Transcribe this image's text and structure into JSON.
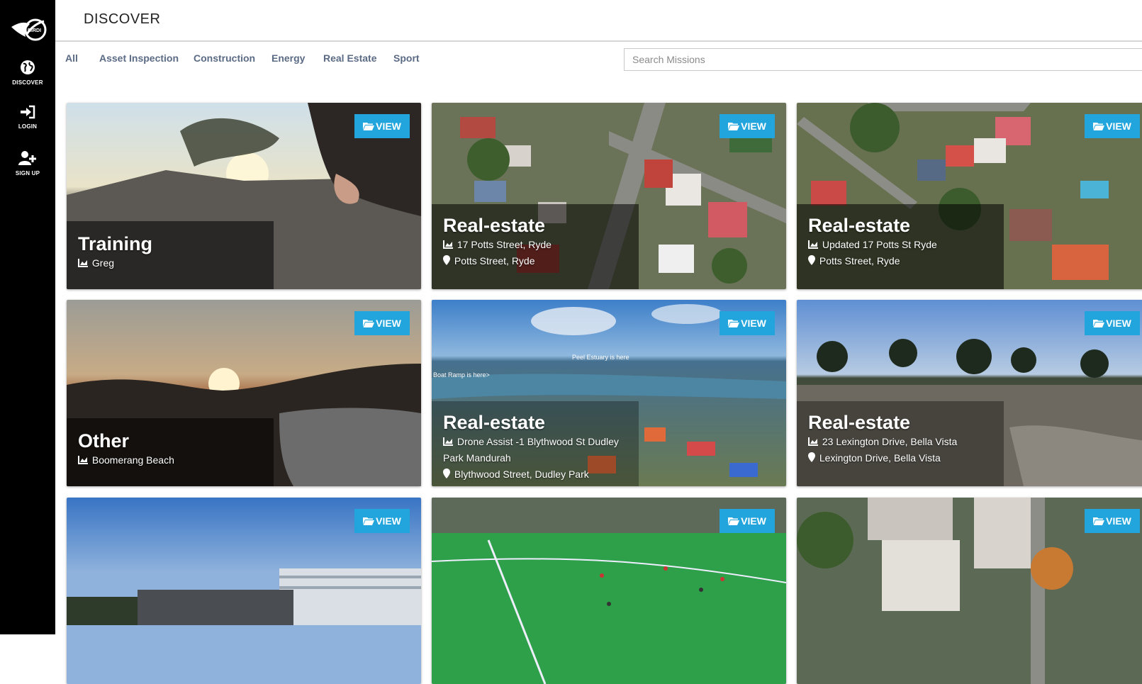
{
  "brand": {
    "logo_text": "BIRDI"
  },
  "sidebar": {
    "items": [
      {
        "label": "DISCOVER",
        "icon": "globe-icon"
      },
      {
        "label": "LOGIN",
        "icon": "login-icon"
      },
      {
        "label": "SIGN UP",
        "icon": "add-user-icon"
      }
    ]
  },
  "header": {
    "title": "DISCOVER"
  },
  "filters": {
    "tabs": [
      "All",
      "Asset Inspection",
      "Construction",
      "Energy",
      "Real Estate",
      "Sport"
    ]
  },
  "search": {
    "placeholder": "Search Missions",
    "value": ""
  },
  "cards": [
    {
      "title": "Training",
      "owner": "Greg",
      "location": "",
      "button": "VIEW"
    },
    {
      "title": "Real-estate",
      "owner": "17 Potts Street, Ryde",
      "location": "Potts Street, Ryde",
      "button": "VIEW"
    },
    {
      "title": "Real-estate",
      "owner": "Updated 17 Potts St Ryde",
      "location": "Potts Street, Ryde",
      "button": "VIEW"
    },
    {
      "title": "Other",
      "owner": "Boomerang Beach",
      "location": "",
      "button": "VIEW"
    },
    {
      "title": "Real-estate",
      "owner": "Drone Assist -1 Blythwood St Dudley",
      "owner_line2": "Park Mandurah",
      "location": "Blythwood Street, Dudley Park",
      "button": "VIEW",
      "image_labels": [
        "Peel Estuary is here",
        "Boat Ramp is here>"
      ]
    },
    {
      "title": "Real-estate",
      "owner": "23 Lexington Drive, Bella Vista",
      "location": "Lexington Drive, Bella Vista",
      "button": "VIEW"
    },
    {
      "title": "",
      "owner": "",
      "location": "",
      "button": "VIEW"
    },
    {
      "title": "",
      "owner": "",
      "location": "",
      "button": "VIEW"
    },
    {
      "title": "",
      "owner": "",
      "location": "",
      "button": "VIEW"
    }
  ]
}
